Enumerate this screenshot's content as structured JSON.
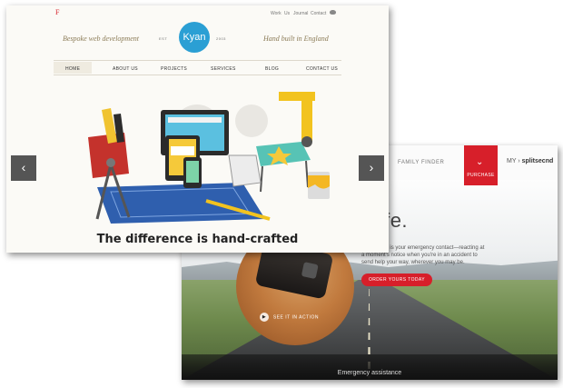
{
  "kyan": {
    "brand_mark": "F",
    "top_links": [
      "Work",
      "Us",
      "Journal",
      "Contact"
    ],
    "tagline_left": "Bespoke web development",
    "tagline_right": "Hand built in England",
    "logo": "Kyan",
    "est_label": "EST",
    "est_year": "2003",
    "nav": [
      "HOME",
      "ABOUT US",
      "PROJECTS",
      "SERVICES",
      "BLOG",
      "CONTACT US"
    ],
    "active_nav": "HOME",
    "prev_arrow": "‹",
    "next_arrow": "›",
    "headline": "The difference is hand-crafted"
  },
  "splitsecnd": {
    "nav_family_finder": "FAMILY FINDER",
    "purchase_label": "PURCHASE",
    "logo_my": "MY",
    "logo_name": "splitsecnd",
    "hero_title": "ve safe.",
    "hero_text_brand": "splitsecnd",
    "hero_text": " is your emergency contact—reacting at a moment's notice when you're in an accident to send help your way, wherever you may be.",
    "order_button": "ORDER YOURS TODAY",
    "see_in_action": "SEE IT IN ACTION",
    "footer_label": "Emergency assistance"
  },
  "colors": {
    "kyan_blue": "#2b9fd4",
    "splitsecnd_red": "#d71f2a"
  }
}
